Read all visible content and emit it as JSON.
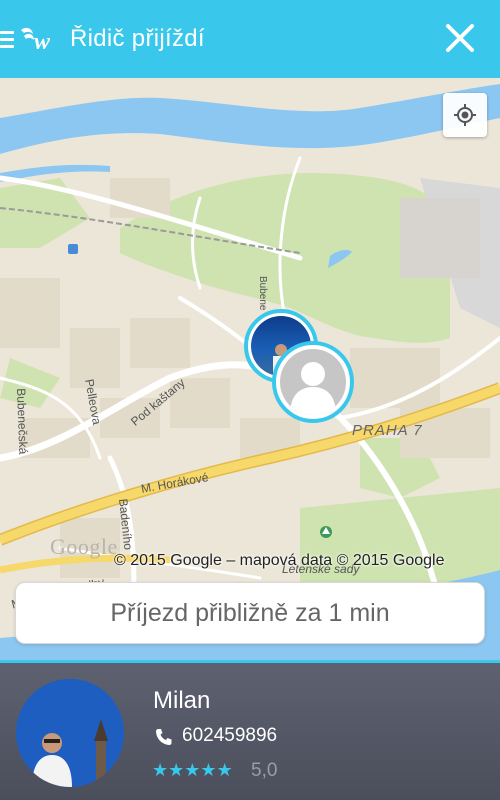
{
  "header": {
    "title": "Řidič přijíždí",
    "close_label": "close"
  },
  "map": {
    "streets": {
      "bubenecska": "Bubenečská",
      "pelleova": "Pelleova",
      "pod_kastany": "Pod kaštany",
      "m_horakove": "M. Horákové",
      "badeniho": "Badeního",
      "buben_top": "Bubene",
      "praha7": "PRAHA 7",
      "letenske_sady": "Letenské sady",
      "nanske_hradby": "Mariánské hradby"
    },
    "copyright": "© 2015 Google – mapová data © 2015 Google",
    "google_logo": "Google",
    "colors": {
      "water": "#8cc7f2",
      "park": "#cfe3b0",
      "highway": "#f7d86b",
      "accent": "#39c8ec"
    }
  },
  "eta": {
    "text": "Příjezd přibližně za 1 min"
  },
  "driver": {
    "name": "Milan",
    "phone": "602459896",
    "rating": "5,0",
    "stars": 5
  }
}
